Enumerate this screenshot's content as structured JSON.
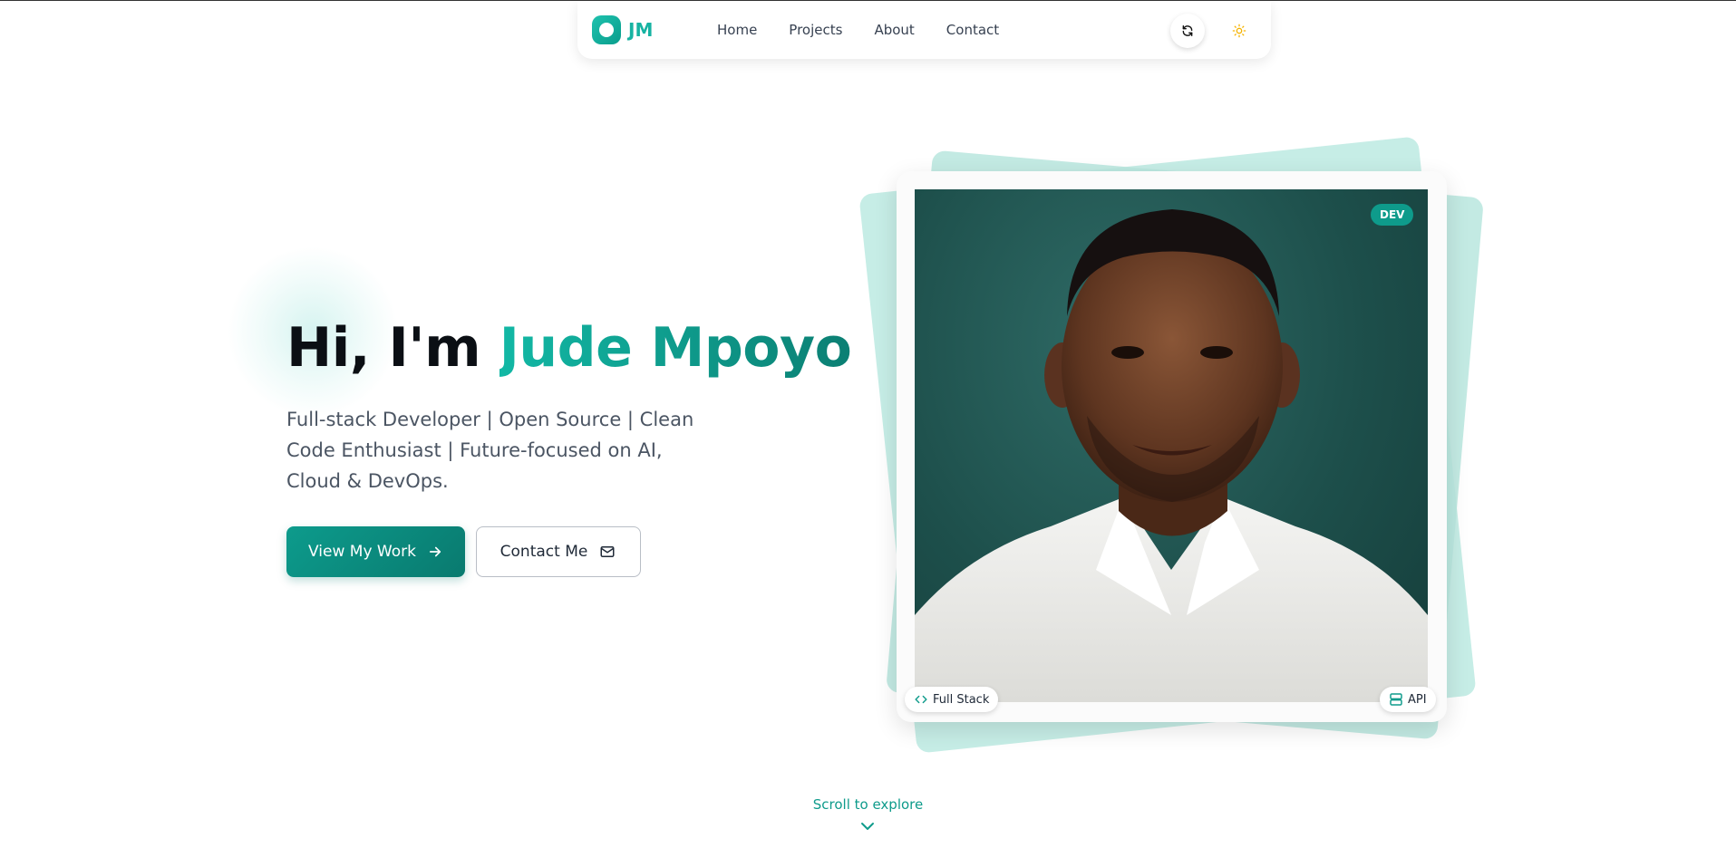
{
  "nav": {
    "logo_text": "JM",
    "links": [
      "Home",
      "Projects",
      "About",
      "Contact"
    ],
    "refresh_icon": "refresh-icon",
    "theme_icon": "sun-icon"
  },
  "hero": {
    "greeting": "Hi, I'm ",
    "name": "Jude Mpoyo",
    "subtitle": "Full-stack Developer | Open Source | Clean Code Enthusiast | Future-focused on AI, Cloud & DevOps.",
    "primary_button": "View My Work",
    "secondary_button": "Contact Me"
  },
  "card": {
    "badge": "DEV",
    "chip_left": "Full Stack",
    "chip_right": "API"
  },
  "scroll": {
    "label": "Scroll to explore"
  },
  "colors": {
    "accent": "#0e9b8b",
    "accent_light": "#1ec2ae",
    "card_bg_shape": "#c6ede6"
  }
}
